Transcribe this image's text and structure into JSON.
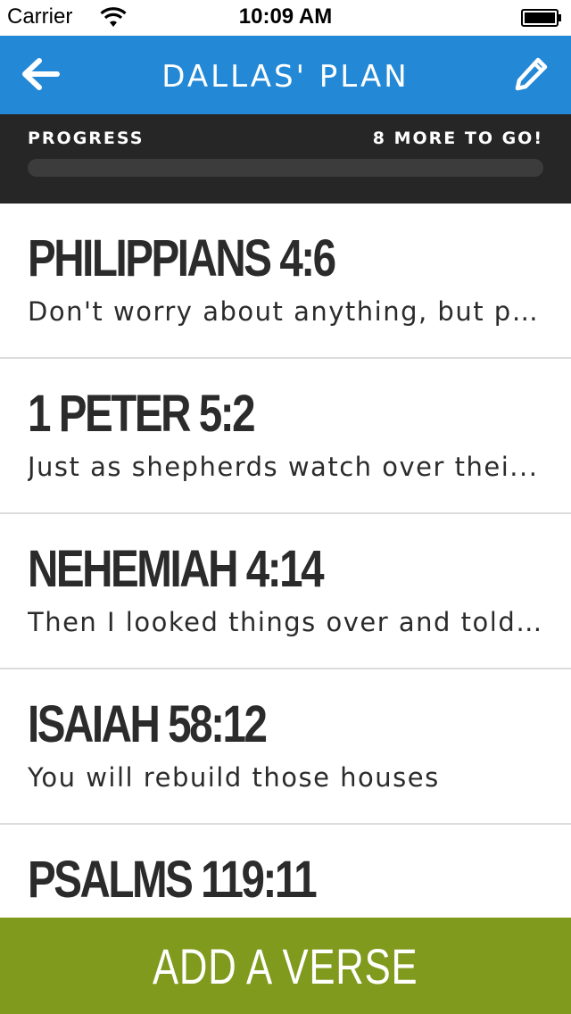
{
  "status_bar": {
    "carrier": "Carrier",
    "time": "10:09 AM",
    "wifi_icon": "wifi-icon",
    "battery_icon": "battery-icon"
  },
  "nav": {
    "title": "DALLAS' PLAN",
    "back_icon": "arrow-left-icon",
    "edit_icon": "pencil-icon",
    "accent_color": "#2389d6"
  },
  "progress": {
    "label": "PROGRESS",
    "remaining": "8 MORE TO GO!",
    "fraction": 0.0
  },
  "verses": [
    {
      "reference": "PHILIPPIANS 4:6",
      "text": "Don't worry about anything, but pr..."
    },
    {
      "reference": "1 PETER 5:2",
      "text": "Just as shepherds watch over thei..."
    },
    {
      "reference": "NEHEMIAH 4:14",
      "text": "Then I looked things over and told ..."
    },
    {
      "reference": "ISAIAH 58:12",
      "text": "You will rebuild those houses"
    },
    {
      "reference": "PSALMS 119:11",
      "text": ""
    }
  ],
  "add_button": {
    "label": "ADD A VERSE",
    "color": "#7f9a1c"
  }
}
